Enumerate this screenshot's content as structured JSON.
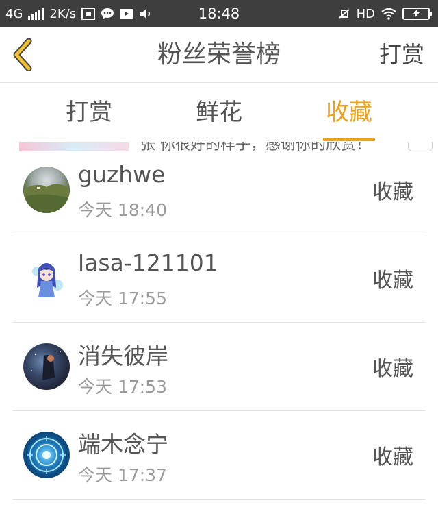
{
  "status_bar": {
    "network": "4G",
    "speed": "2K/s",
    "time": "18:48",
    "hd": "HD",
    "battery_icon": "battery-charging-icon"
  },
  "header": {
    "title": "粉丝荣誉榜",
    "right_action": "打赏",
    "back_icon": "chevron-left-icon",
    "accent_color": "#f0a016"
  },
  "tabs": [
    {
      "label": "打赏",
      "active": false
    },
    {
      "label": "鲜花",
      "active": false
    },
    {
      "label": "收藏",
      "active": true
    }
  ],
  "peek": {
    "text": "张 你很好的样子，感谢你的欣赏！"
  },
  "fans": [
    {
      "name": "guzhwe",
      "time": "今天 18:40",
      "action": "收藏",
      "avatar": "landscape-photo"
    },
    {
      "name": "lasa-121101",
      "time": "今天 17:55",
      "action": "收藏",
      "avatar": "anime-girl-illustration"
    },
    {
      "name": "消失彼岸",
      "time": "今天 17:53",
      "action": "收藏",
      "avatar": "dark-night-figure"
    },
    {
      "name": "端木念宁",
      "time": "今天 17:37",
      "action": "收藏",
      "avatar": "blue-zodiac-wheel"
    }
  ]
}
